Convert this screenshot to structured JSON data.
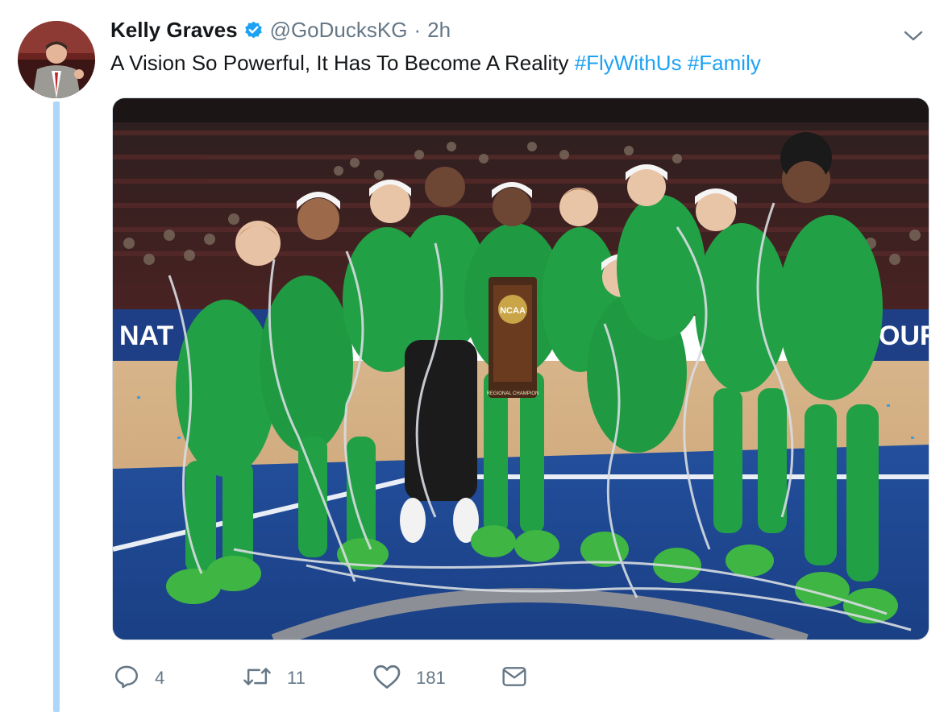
{
  "tweet": {
    "author_name": "Kelly Graves",
    "author_handle": "@GoDucksKG",
    "separator": "·",
    "timestamp": "2h",
    "text": "A Vision So Powerful, It Has To Become A Reality",
    "hashtags": [
      "#FlyWithUs",
      "#Family"
    ],
    "verified": true
  },
  "media": {
    "trophy_brand": "NCAA",
    "trophy_caption": "REGIONAL CHAMPION",
    "banner_left": "NAT",
    "banner_right": "OUR"
  },
  "actions": {
    "reply_count": "4",
    "retweet_count": "11",
    "like_count": "181"
  },
  "icons": {
    "verified": "verified-badge-icon",
    "menu": "chevron-down-icon",
    "reply": "reply-icon",
    "retweet": "retweet-icon",
    "like": "heart-icon",
    "message": "envelope-icon"
  },
  "colors": {
    "accent": "#1da1f2",
    "thread_line": "#aed6f9",
    "muted_text": "#657786",
    "team_green": "#22a046",
    "team_yellow": "#f2e01b"
  }
}
